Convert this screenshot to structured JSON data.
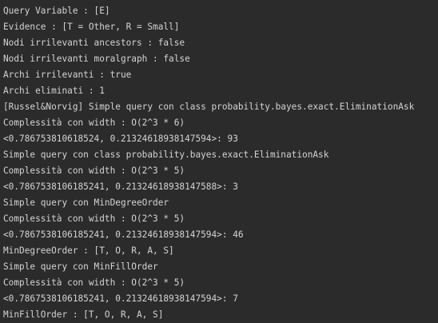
{
  "console": {
    "lines": [
      "Query Variable : [E]",
      "Evidence : [T = Other, R = Small]",
      "Nodi irrilevanti ancestors : false",
      "Nodi irrilevanti moralgraph : false",
      "Archi irrilevanti : true",
      "Archi eliminati : 1",
      "[Russel&Norvig] Simple query con class probability.bayes.exact.EliminationAsk",
      "Complessità con width : O(2^3 * 6)",
      "<0.786753810618524, 0.21324618938147594>: 93",
      "Simple query con class probability.bayes.exact.EliminationAsk",
      "Complessità con width : O(2^3 * 5)",
      "<0.7867538106185241, 0.21324618938147588>: 3",
      "Simple query con MinDegreeOrder",
      "Complessità con width : O(2^3 * 5)",
      "<0.7867538106185241, 0.21324618938147594>: 46",
      "MinDegreeOrder : [T, O, R, A, S]",
      "Simple query con MinFillOrder",
      "Complessità con width : O(2^3 * 5)",
      "<0.7867538106185241, 0.21324618938147594>: 7",
      "MinFillOrder : [T, O, R, A, S]"
    ]
  }
}
